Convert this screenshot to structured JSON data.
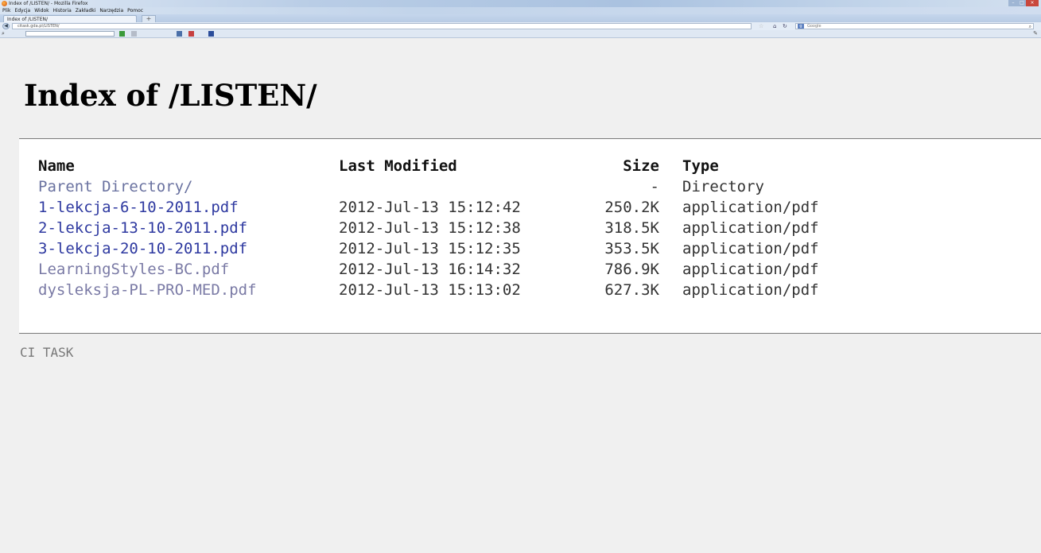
{
  "window": {
    "title": "Index of /LISTEN/ - Mozilla Firefox"
  },
  "menu": {
    "items": [
      "Plik",
      "Edycja",
      "Widok",
      "Historia",
      "Zakładki",
      "Narzędzia",
      "Pomoc"
    ]
  },
  "tabs": [
    {
      "label": "Index of /LISTEN/"
    }
  ],
  "navigation": {
    "url": "citask.gda.pl/LISTEN/",
    "search_engine": "Google"
  },
  "page": {
    "title": "Index of /LISTEN/",
    "footer": "CI TASK"
  },
  "listing": {
    "headers": {
      "name": "Name",
      "modified": "Last Modified",
      "size": "Size",
      "type": "Type"
    },
    "rows": [
      {
        "name": "Parent Directory/",
        "modified": "",
        "size": "-",
        "type": "Directory"
      },
      {
        "name": "1-lekcja-6-10-2011.pdf",
        "modified": "2012-Jul-13 15:12:42",
        "size": "250.2K",
        "type": "application/pdf"
      },
      {
        "name": "2-lekcja-13-10-2011.pdf",
        "modified": "2012-Jul-13 15:12:38",
        "size": "318.5K",
        "type": "application/pdf"
      },
      {
        "name": "3-lekcja-20-10-2011.pdf",
        "modified": "2012-Jul-13 15:12:35",
        "size": "353.5K",
        "type": "application/pdf"
      },
      {
        "name": "LearningStyles-BC.pdf",
        "modified": "2012-Jul-13 16:14:32",
        "size": "786.9K",
        "type": "application/pdf"
      },
      {
        "name": "dysleksja-PL-PRO-MED.pdf",
        "modified": "2012-Jul-13 15:13:02",
        "size": "627.3K",
        "type": "application/pdf"
      }
    ]
  },
  "colors": {
    "link": "#2e39a0",
    "visited_link": "#7a7aa5",
    "page_background": "#f0f0f0",
    "listing_background": "#ffffff"
  },
  "icons": {
    "browser_logo": "firefox-icon",
    "back": "back-arrow-icon",
    "bookmark": "star-icon",
    "home": "home-icon",
    "reload": "reload-icon",
    "search": "magnifier-icon"
  }
}
